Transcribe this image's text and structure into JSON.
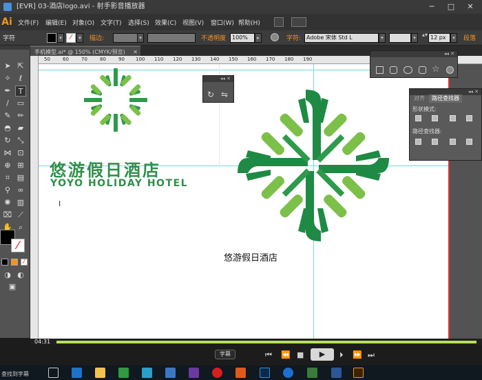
{
  "window": {
    "title": "[EVR] 03-酒店logo.avi - 射手影音播放器",
    "min": "─",
    "max": "□",
    "close": "✕"
  },
  "app_logo": "Ai",
  "menu": [
    "文件(F)",
    "编辑(E)",
    "对象(O)",
    "文字(T)",
    "选择(S)",
    "效果(C)",
    "视图(V)",
    "窗口(W)",
    "帮助(H)"
  ],
  "control": {
    "mode_label": "字符",
    "stroke_label": "描边:",
    "opacity_label": "不透明度",
    "opacity_value": "100%",
    "char_label": "字符:",
    "font_value": "Adobe 宋体 Std L",
    "size_value": "12 px",
    "para_label": "段落"
  },
  "doc_tab": "手机模型.ai* @ 150% (CMYK/预览)",
  "ruler_ticks": [
    "50",
    "60",
    "70",
    "80",
    "90",
    "100",
    "110",
    "120",
    "130",
    "140",
    "150",
    "160",
    "170",
    "180",
    "190"
  ],
  "artwork": {
    "hotel_cn": "悠游假日酒店",
    "hotel_en": "YOYO HOLIDAY HOTEL",
    "caption": "悠游假日酒店",
    "colors": {
      "dark_green": "#1e8a44",
      "light_green": "#7cc04a"
    }
  },
  "pathfinder": {
    "tab_align": "对齐",
    "tab_pathfinder": "路径查找器",
    "shape_modes": "形状模式:",
    "pathfinders": "路径查找器:"
  },
  "player": {
    "time": "04:31",
    "progress": 0.99,
    "subtitle_button": "字幕",
    "accent": "#b6e05a"
  },
  "taskbar": {
    "search_text": "查找到字幕",
    "apps": [
      "task-view-icon",
      "edge-icon",
      "explorer-icon",
      "store-icon",
      "sync-icon",
      "mail-icon",
      "record-icon",
      "wps-icon",
      "photoshop-icon",
      "sogou-icon",
      "network-icon",
      "word-icon",
      "illustrator-icon"
    ]
  }
}
